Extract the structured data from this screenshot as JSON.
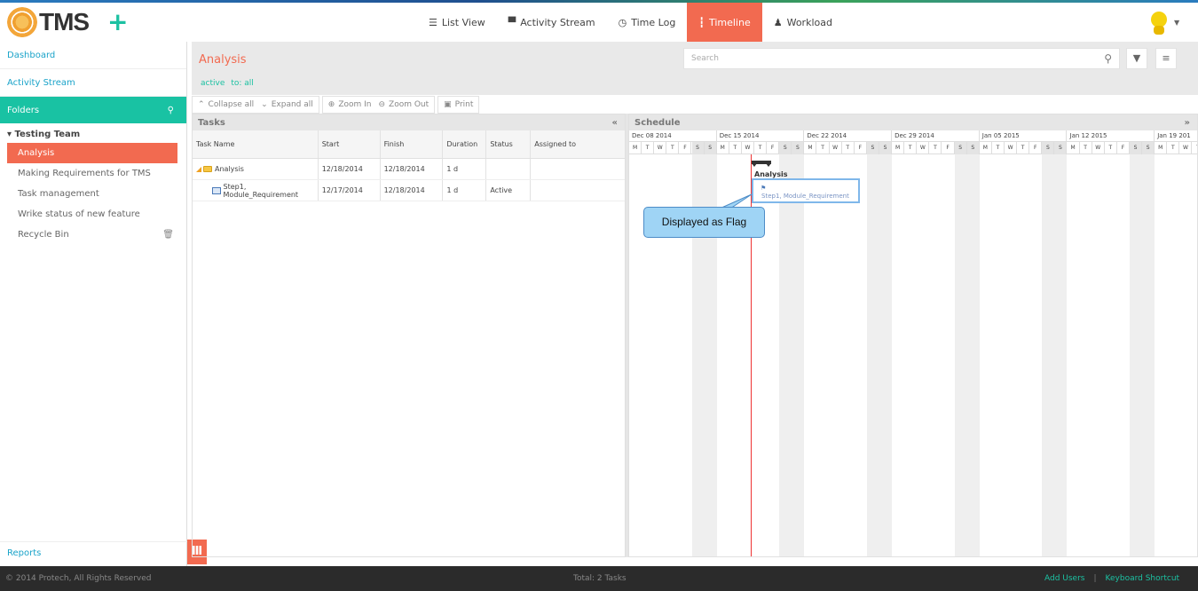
{
  "app": {
    "logo_text": "TMS",
    "add_icon": "plus-icon"
  },
  "nav": {
    "items": [
      {
        "label": "List View",
        "icon": "list-icon"
      },
      {
        "label": "Activity Stream",
        "icon": "comment-icon"
      },
      {
        "label": "Time Log",
        "icon": "clock-icon"
      },
      {
        "label": "Timeline",
        "icon": "timeline-icon",
        "active": true
      },
      {
        "label": "Workload",
        "icon": "user-icon"
      }
    ]
  },
  "sidebar": {
    "dashboard": "Dashboard",
    "activity_stream": "Activity Stream",
    "folders": "Folders",
    "team": "Testing Team",
    "items": [
      {
        "label": "Analysis",
        "active": true
      },
      {
        "label": "Making Requirements for TMS"
      },
      {
        "label": "Task management"
      },
      {
        "label": "Wrike status of new feature"
      },
      {
        "label": "Recycle Bin"
      }
    ],
    "reports": "Reports"
  },
  "header": {
    "title": "Analysis",
    "filter_status": "active",
    "filter_to": "to: all",
    "search_placeholder": "Search"
  },
  "toolbar": {
    "collapse_all": "Collapse all",
    "expand_all": "Expand all",
    "zoom_in": "Zoom In",
    "zoom_out": "Zoom Out",
    "print": "Print"
  },
  "tasks": {
    "pane_title": "Tasks",
    "columns": [
      "Task Name",
      "Start",
      "Finish",
      "Duration",
      "Status",
      "Assigned to"
    ],
    "rows": [
      {
        "name": "Analysis",
        "start": "12/18/2014",
        "finish": "12/18/2014",
        "duration": "1 d",
        "status": "",
        "assigned": ""
      },
      {
        "name": "Step1, Module_Requirement",
        "start": "12/17/2014",
        "finish": "12/18/2014",
        "duration": "1 d",
        "status": "Active",
        "assigned": ""
      }
    ]
  },
  "schedule": {
    "pane_title": "Schedule",
    "weeks": [
      "Dec 08 2014",
      "Dec 15 2014",
      "Dec 22 2014",
      "Dec 29 2014",
      "Jan 05 2015",
      "Jan 12 2015",
      "Jan 19 201"
    ],
    "day_letters": [
      "M",
      "T",
      "W",
      "T",
      "F",
      "S",
      "S"
    ],
    "summary_label": "Analysis",
    "flag_label": "Step1, Module_Requirement",
    "callout_text": "Displayed as Flag"
  },
  "footer": {
    "copyright": "© 2014 Protech, All Rights Reserved",
    "total": "Total: 2 Tasks",
    "add_users": "Add Users",
    "separator": "|",
    "keyboard_shortcut": "Keyboard Shortcut"
  }
}
